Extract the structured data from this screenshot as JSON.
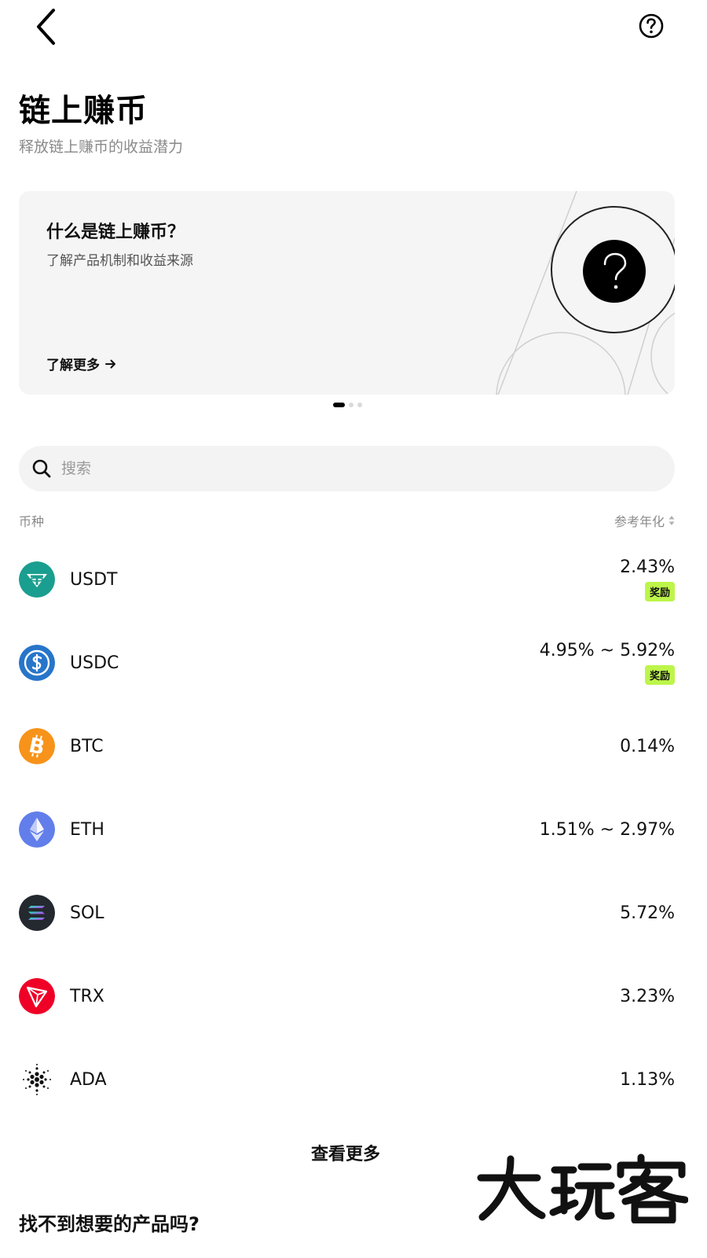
{
  "header": {
    "title": "链上赚币",
    "subtitle": "释放链上赚币的收益潜力"
  },
  "banner": {
    "title": "什么是链上赚币？",
    "description": "了解产品机制和收益来源",
    "link_label": "了解更多"
  },
  "carousel": {
    "total": 3,
    "active": 0
  },
  "search": {
    "placeholder": "搜索",
    "value": ""
  },
  "list_header": {
    "coin_label": "币种",
    "apy_label": "参考年化"
  },
  "coins": [
    {
      "symbol": "USDT",
      "apy": "2.43%",
      "badge": "奖励",
      "icon": "usdt-icon",
      "color": "#26a17b"
    },
    {
      "symbol": "USDC",
      "apy": "4.95% ~ 5.92%",
      "badge": "奖励",
      "icon": "usdc-icon",
      "color": "#2775ca"
    },
    {
      "symbol": "BTC",
      "apy": "0.14%",
      "badge": "",
      "icon": "btc-icon",
      "color": "#f7931a"
    },
    {
      "symbol": "ETH",
      "apy": "1.51% ~ 2.97%",
      "badge": "",
      "icon": "eth-icon",
      "color": "#627eea"
    },
    {
      "symbol": "SOL",
      "apy": "5.72%",
      "badge": "",
      "icon": "sol-icon",
      "color": "#24282f"
    },
    {
      "symbol": "TRX",
      "apy": "3.23%",
      "badge": "",
      "icon": "trx-icon",
      "color": "#ef0027"
    },
    {
      "symbol": "ADA",
      "apy": "1.13%",
      "badge": "",
      "icon": "ada-icon",
      "color": "#0033ad"
    }
  ],
  "see_more_label": "查看更多",
  "bottom_section_title": "找不到想要的产品吗?",
  "watermark_text": "大玩客",
  "colors": {
    "accent_badge": "#bdf54a",
    "banner_bg": "#f5f5f5",
    "search_bg": "#f3f3f3"
  }
}
